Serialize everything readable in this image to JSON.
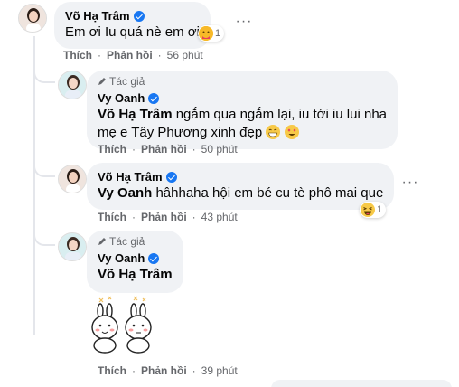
{
  "colors": {
    "bubble": "#f0f2f5",
    "verified": "#1877f2",
    "muted": "#65676b",
    "thread": "#e4e6eb"
  },
  "comments": [
    {
      "author": "Võ Hạ Trâm",
      "text": "Em ơi Iu quá nè em ơi",
      "reaction_count": "1",
      "actions": {
        "like": "Thích",
        "reply": "Phản hồi",
        "time": "56 phút"
      }
    },
    {
      "badge": "Tác giả",
      "author": "Vy Oanh",
      "mention": "Võ Hạ Trâm",
      "text_line1": "ngắm qua ngắm lại, iu tới iu lui nha",
      "text_line2": "mẹ e Tây Phương xinh đẹp",
      "actions": {
        "like": "Thích",
        "reply": "Phản hồi",
        "time": "50 phút"
      }
    },
    {
      "author": "Võ Hạ Trâm",
      "mention": "Vy Oanh",
      "text": "hâhhaha hội em bé cu tè phô mai que",
      "reaction_count": "1",
      "actions": {
        "like": "Thích",
        "reply": "Phản hồi",
        "time": "43 phút"
      }
    },
    {
      "badge": "Tác giả",
      "author": "Vy Oanh",
      "mention": "Võ Hạ Trâm",
      "sticker": "two-bunnies-sticker",
      "actions": {
        "like": "Thích",
        "reply": "Phản hồi",
        "time": "39 phút"
      }
    }
  ],
  "separator": "·",
  "more_glyph": "···"
}
